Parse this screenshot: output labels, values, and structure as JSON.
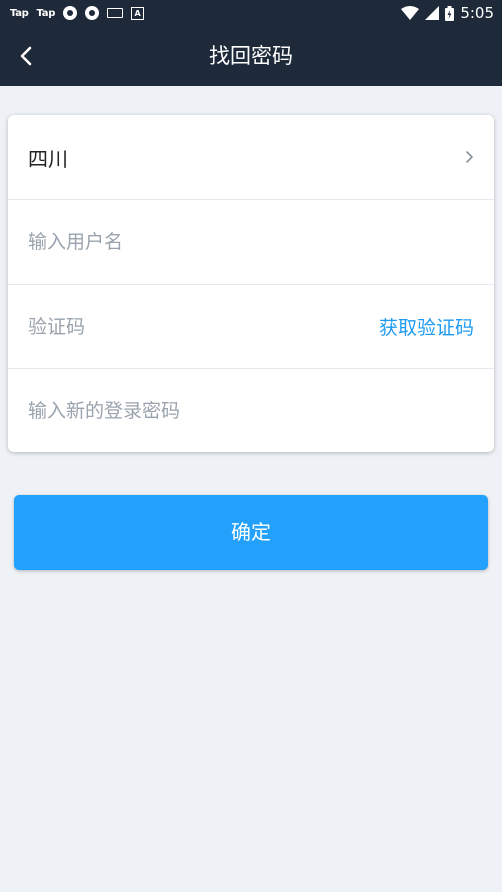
{
  "status_bar": {
    "left_texts": [
      "Tap",
      "Tap"
    ],
    "icons": [
      "app-icon",
      "app-icon",
      "keyboard-icon",
      "a-icon"
    ],
    "time": "5:05"
  },
  "nav": {
    "title": "找回密码",
    "back_icon": "chevron-left-icon"
  },
  "form": {
    "region": "四川",
    "username_placeholder": "输入用户名",
    "code_placeholder": "验证码",
    "get_code_label": "获取验证码",
    "new_password_placeholder": "输入新的登录密码"
  },
  "confirm_label": "确定",
  "colors": {
    "header_bg": "#1e2a3a",
    "page_bg": "#eef1f6",
    "accent": "#22a0fb",
    "link": "#1e9bf0"
  }
}
